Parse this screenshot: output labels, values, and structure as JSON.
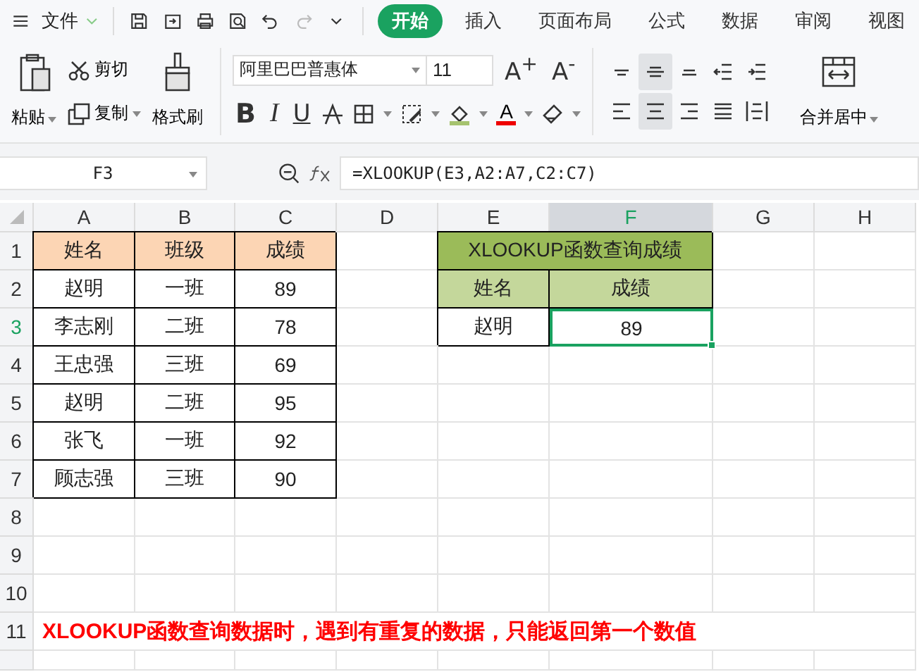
{
  "menu": {
    "file": "文件",
    "tabs": [
      {
        "label": "开始",
        "selected": true
      },
      {
        "label": "插入",
        "selected": false
      },
      {
        "label": "页面布局",
        "selected": false
      },
      {
        "label": "公式",
        "selected": false
      },
      {
        "label": "数据",
        "selected": false
      },
      {
        "label": "审阅",
        "selected": false
      },
      {
        "label": "视图",
        "selected": false
      }
    ]
  },
  "clipboard": {
    "paste": "粘贴",
    "cut": "剪切",
    "copy": "复制",
    "format_painter": "格式刷"
  },
  "font": {
    "name": "阿里巴巴普惠体",
    "size": "11",
    "grow": "A$^{+}$",
    "shrink": "A$^{-}$",
    "bold": "B",
    "italic": "I",
    "underline": "U",
    "color_glyph": "A"
  },
  "alignment": [
    {
      "kind": "top",
      "selected": false
    },
    {
      "kind": "middle",
      "selected": true
    },
    {
      "kind": "bottom",
      "selected": false
    },
    {
      "kind": "outdent",
      "selected": false
    },
    {
      "kind": "indent",
      "selected": false
    },
    {
      "kind": "left",
      "selected": false
    },
    {
      "kind": "center",
      "selected": true
    },
    {
      "kind": "right",
      "selected": false
    },
    {
      "kind": "justify",
      "selected": false
    },
    {
      "kind": "distribute",
      "selected": false
    }
  ],
  "merge": {
    "label": "合并居中"
  },
  "formula_bar": {
    "name_box": "F3",
    "formula": "=XLOOKUP(E3,A2:A7,C2:C7)"
  },
  "columns": [
    {
      "label": "A",
      "selected": false
    },
    {
      "label": "B",
      "selected": false
    },
    {
      "label": "C",
      "selected": false
    },
    {
      "label": "D",
      "selected": false
    },
    {
      "label": "E",
      "selected": false
    },
    {
      "label": "F",
      "selected": true
    },
    {
      "label": "G",
      "selected": false
    },
    {
      "label": "H",
      "selected": false
    }
  ],
  "rows": [
    {
      "number": "1",
      "selected": false
    },
    {
      "number": "2",
      "selected": false
    },
    {
      "number": "3",
      "selected": true
    },
    {
      "number": "4",
      "selected": false
    },
    {
      "number": "5",
      "selected": false
    },
    {
      "number": "6",
      "selected": false
    },
    {
      "number": "7",
      "selected": false
    },
    {
      "number": "8",
      "selected": false
    },
    {
      "number": "9",
      "selected": false
    },
    {
      "number": "10",
      "selected": false
    },
    {
      "number": "11",
      "selected": false
    }
  ],
  "scores_table": {
    "header": [
      "姓名",
      "班级",
      "成绩"
    ],
    "rows": [
      [
        "赵明",
        "一班",
        "89"
      ],
      [
        "李志刚",
        "二班",
        "78"
      ],
      [
        "王忠强",
        "三班",
        "69"
      ],
      [
        "赵明",
        "二班",
        "95"
      ],
      [
        "张飞",
        "一班",
        "92"
      ],
      [
        "顾志强",
        "三班",
        "90"
      ]
    ]
  },
  "lookup_table": {
    "title": "XLOOKUP函数查询成绩",
    "header": [
      "姓名",
      "成绩"
    ],
    "name": "赵明",
    "result": {
      "text": "89",
      "active": true
    }
  },
  "note": "XLOOKUP函数查询数据时，遇到有重复的数据，只能返回第一个数值"
}
